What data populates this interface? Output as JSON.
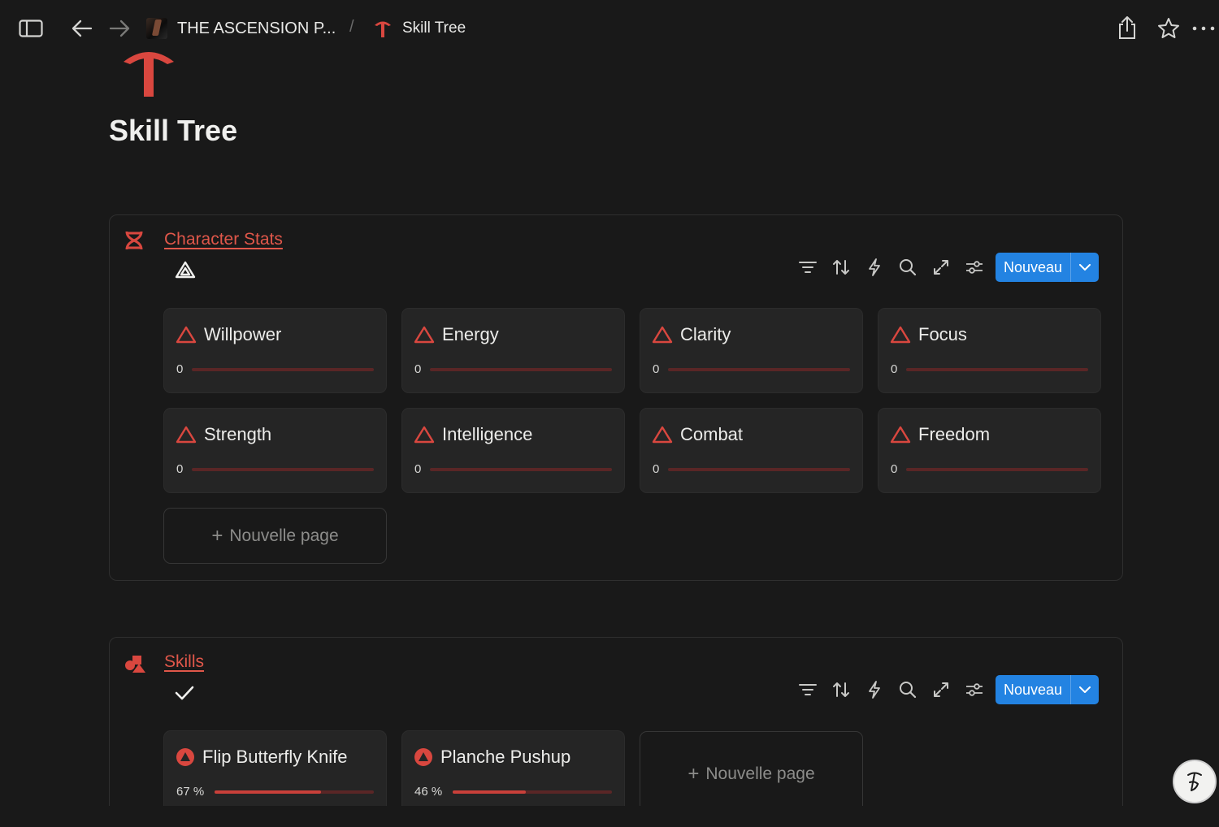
{
  "topbar": {
    "workspace_label": "THE ASCENSION P...",
    "separator": "/",
    "page_label": "Skill Tree"
  },
  "page": {
    "title": "Skill Tree",
    "accent_color": "#d9473f"
  },
  "character_stats": {
    "title": "Character Stats",
    "new_label": "Nouveau",
    "new_page_label": "Nouvelle page",
    "cards": [
      {
        "name": "Willpower",
        "value": "0",
        "progress": 0
      },
      {
        "name": "Energy",
        "value": "0",
        "progress": 0
      },
      {
        "name": "Clarity",
        "value": "0",
        "progress": 0
      },
      {
        "name": "Focus",
        "value": "0",
        "progress": 0
      },
      {
        "name": "Strength",
        "value": "0",
        "progress": 0
      },
      {
        "name": "Intelligence",
        "value": "0",
        "progress": 0
      },
      {
        "name": "Combat",
        "value": "0",
        "progress": 0
      },
      {
        "name": "Freedom",
        "value": "0",
        "progress": 0
      }
    ]
  },
  "skills": {
    "title": "Skills",
    "new_label": "Nouveau",
    "new_page_label": "Nouvelle page",
    "cards": [
      {
        "name": "Flip Butterfly Knife",
        "value": "67 %",
        "progress": 0.67
      },
      {
        "name": "Planche Pushup",
        "value": "46 %",
        "progress": 0.46
      }
    ]
  }
}
